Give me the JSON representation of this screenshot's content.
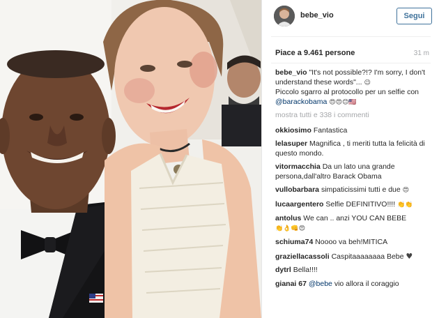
{
  "post": {
    "username": "bebe_vio",
    "follow_label": "Segui",
    "likes": "Piace a 9.461 persone",
    "time": "31 m",
    "caption": {
      "user": "bebe_vio",
      "text": "\"It's not possible?!? I'm sorry, I don't understand these words\"...",
      "emoji1": "😉",
      "text2": "Piccolo sgarro al protocollo per un selfie con ",
      "mention": "@barackobama",
      "emoji2": "😍😍😊🇺🇸"
    },
    "load_more": "mostra tutti e 338 i commenti"
  },
  "comments": [
    {
      "user": "okkiosimo",
      "text": "Fantastica",
      "emoji": ""
    },
    {
      "user": "lelasuper",
      "text": "Magnifica , ti meriti tutta la felicità di questo mondo.",
      "emoji": ""
    },
    {
      "user": "vitormacchia",
      "text": "Da un lato una grande persona,dall'altro Barack Obama",
      "emoji": ""
    },
    {
      "user": "vullobarbara",
      "text": "simpaticissimi tutti e due",
      "emoji": "😍"
    },
    {
      "user": "lucaargentero",
      "text": "Selfie DEFINITIVO!!!!",
      "emoji": "👏👏"
    },
    {
      "user": "antolus",
      "text": "We can .. anzi YOU CAN BEBE",
      "emoji": "👏👌👊😍"
    },
    {
      "user": "schiuma74",
      "text": "Noooo va beh!MITICA",
      "emoji": ""
    },
    {
      "user": "graziellacassoli",
      "text": "Caspitaaaaaaaa Bebe",
      "emoji": "♥"
    },
    {
      "user": "dytrl",
      "text": "Bella!!!!",
      "emoji": ""
    },
    {
      "user": "gianai",
      "text": "",
      "mention": "@bebe",
      "prefix": "67 ",
      "tail": " vio allora il coraggio",
      "emoji": ""
    }
  ]
}
